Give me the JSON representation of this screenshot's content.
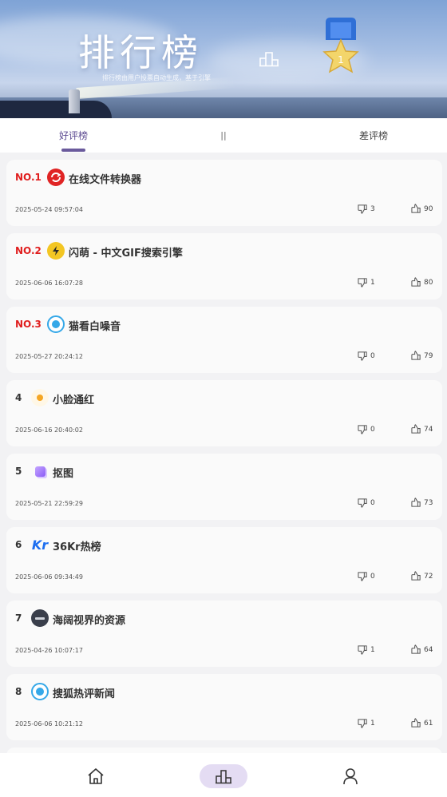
{
  "banner": {
    "title": "排行榜",
    "subtitle": "排行榜由用户投票自动生成，基于引擎",
    "medal_number": "1"
  },
  "tabs": {
    "good": "好评榜",
    "separator": "||",
    "bad": "差评榜"
  },
  "items": [
    {
      "rank": "NO.1",
      "name": "在线文件转换器",
      "time": "2025-05-24 09:57:04",
      "dislikes": "3",
      "likes": "90",
      "icon": "convert-icon",
      "icon_color": "#e02424"
    },
    {
      "rank": "NO.2",
      "name": "闪萌 - 中文GIF搜索引擎",
      "time": "2025-06-06 16:07:28",
      "dislikes": "1",
      "likes": "80",
      "icon": "lightning-icon",
      "icon_color": "#f3c623"
    },
    {
      "rank": "NO.3",
      "name": "猫看白噪音",
      "time": "2025-05-27 20:24:12",
      "dislikes": "0",
      "likes": "79",
      "icon": "circle-dot-icon",
      "icon_color": "#35a8e8"
    },
    {
      "rank": "4",
      "name": "小脸通红",
      "time": "2025-06-16 20:40:02",
      "dislikes": "0",
      "likes": "74",
      "icon": "sun-icon",
      "icon_color": "#f5a623"
    },
    {
      "rank": "5",
      "name": "抠图",
      "time": "2025-05-21 22:59:29",
      "dislikes": "0",
      "likes": "73",
      "icon": "cutout-icon",
      "icon_color": "#8b5cf6"
    },
    {
      "rank": "6",
      "name": "36Kr热榜",
      "time": "2025-06-06 09:34:49",
      "dislikes": "0",
      "likes": "72",
      "icon": "kr-logo-icon",
      "icon_color": "#1e6ff0"
    },
    {
      "rank": "7",
      "name": "海阔视界的资源",
      "time": "2025-04-26 10:07:17",
      "dislikes": "1",
      "likes": "64",
      "icon": "dark-badge-icon",
      "icon_color": "#3a3f4b"
    },
    {
      "rank": "8",
      "name": "搜狐热评新闻",
      "time": "2025-06-06 10:21:12",
      "dislikes": "1",
      "likes": "61",
      "icon": "circle-dot-icon",
      "icon_color": "#35a8e8"
    }
  ],
  "nav": {
    "home_icon": "home-icon",
    "rank_icon": "podium-icon",
    "user_icon": "user-icon"
  }
}
